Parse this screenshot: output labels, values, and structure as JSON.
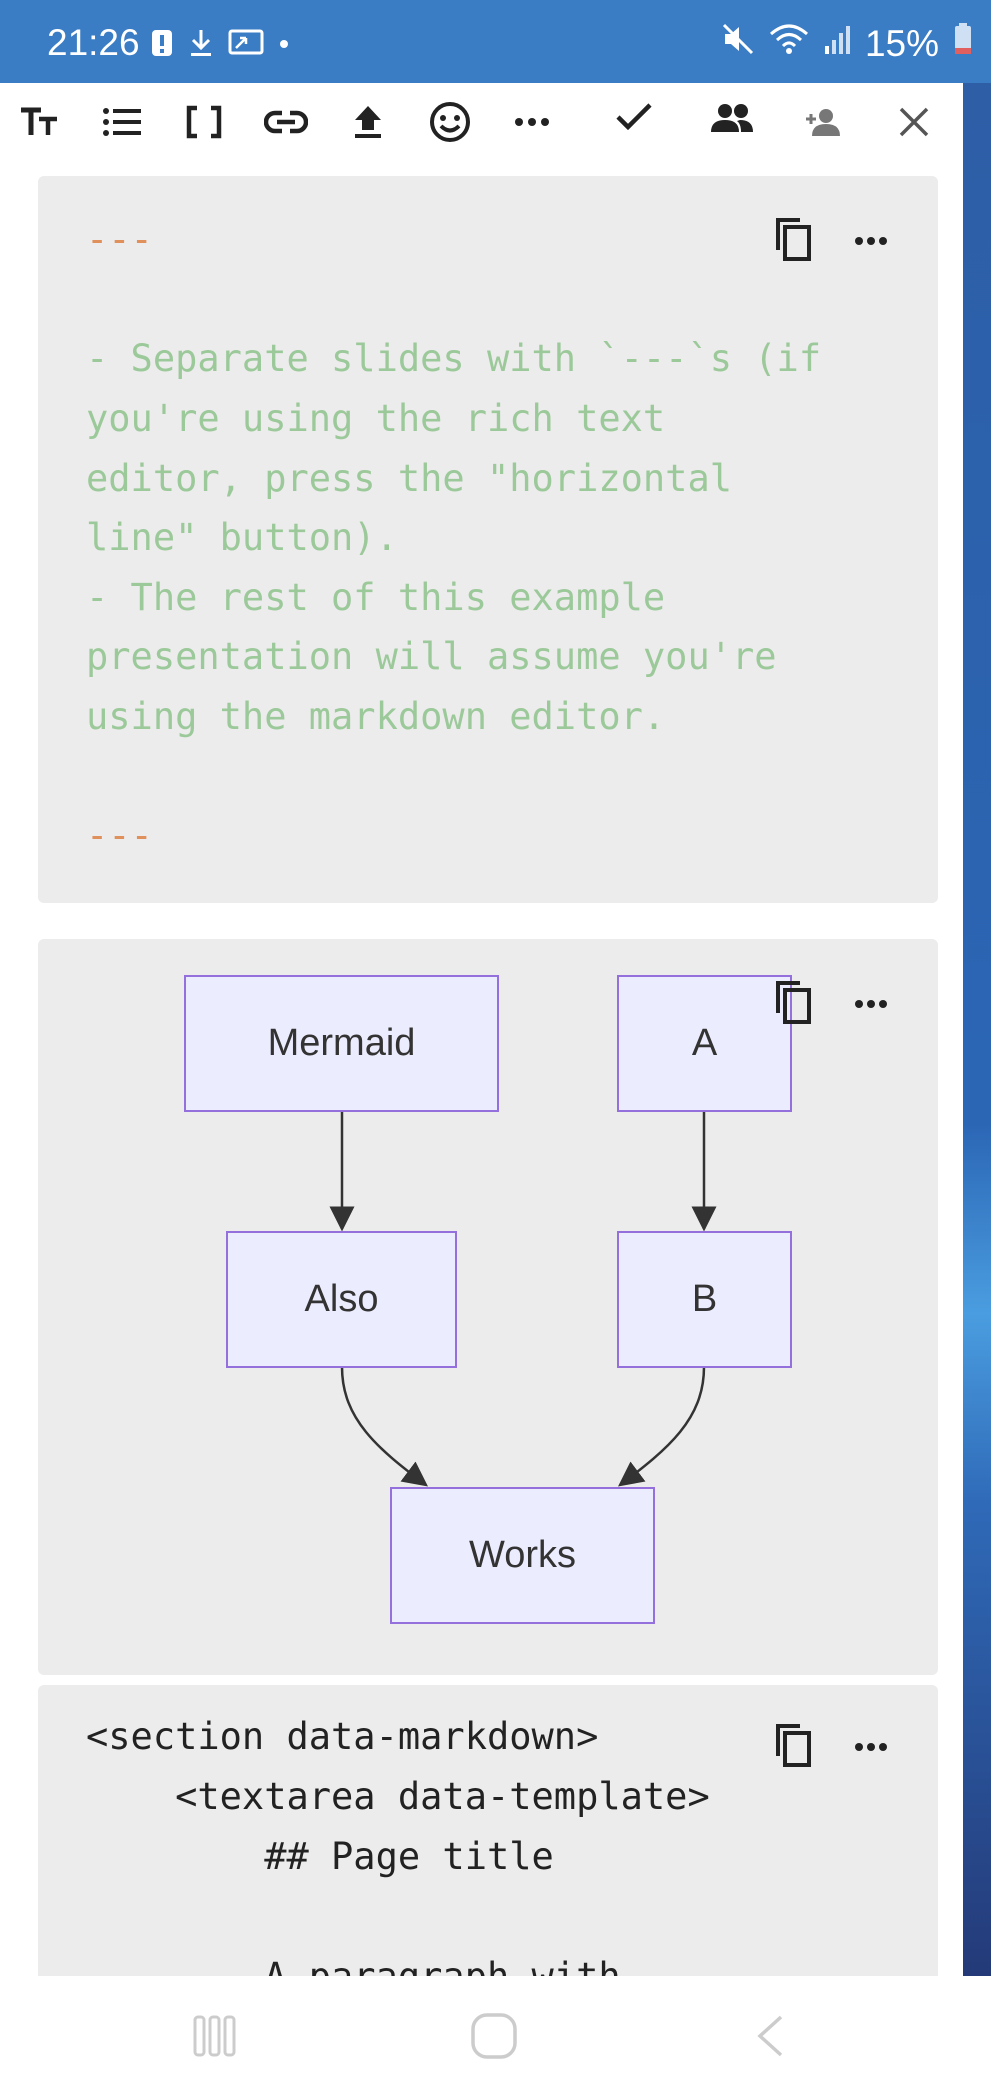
{
  "status_bar": {
    "time": "21:26",
    "battery": "15%",
    "icons": [
      "alert-icon",
      "download-icon",
      "screen-cast-icon",
      "dot-icon",
      "mute-icon",
      "wifi-icon",
      "signal-icon",
      "battery-icon"
    ]
  },
  "toolbar": {
    "icons": [
      "text-size-icon",
      "list-icon",
      "brackets-icon",
      "link-icon",
      "upload-icon",
      "emoji-icon",
      "more-icon",
      "check-icon",
      "people-icon",
      "add-person-icon",
      "close-icon"
    ]
  },
  "card1": {
    "lines": [
      {
        "text": "---",
        "style": "dashes"
      },
      {
        "text": "",
        "style": "green"
      },
      {
        "text": "- Separate slides with `---`s (if",
        "style": "green"
      },
      {
        "text": "you're using the rich text",
        "style": "green"
      },
      {
        "text": "editor, press the \"horizontal",
        "style": "green"
      },
      {
        "text": "line\" button).",
        "style": "green"
      },
      {
        "text": "- The rest of this example",
        "style": "green"
      },
      {
        "text": "presentation will assume you're",
        "style": "green"
      },
      {
        "text": "using the markdown editor.",
        "style": "green"
      },
      {
        "text": "",
        "style": "green"
      },
      {
        "text": "---",
        "style": "dashes"
      }
    ]
  },
  "card2": {
    "diagram": {
      "nodes": {
        "mermaid": "Mermaid",
        "a": "A",
        "also": "Also",
        "b": "B",
        "works": "Works"
      },
      "edges": [
        [
          "Mermaid",
          "Also"
        ],
        [
          "A",
          "B"
        ],
        [
          "Also",
          "Works"
        ],
        [
          "B",
          "Works"
        ]
      ]
    }
  },
  "card3": {
    "lines": [
      "<section data-markdown>",
      "    <textarea data-template>",
      "        ## Page title",
      "",
      "        A paragraph with"
    ]
  },
  "colors": {
    "status_bar": "#3a7dc5",
    "card_bg": "#ececec",
    "node_fill": "#ececff",
    "node_border": "#9370db",
    "dashes": "#e0905a",
    "green_text": "#9cc99a"
  }
}
